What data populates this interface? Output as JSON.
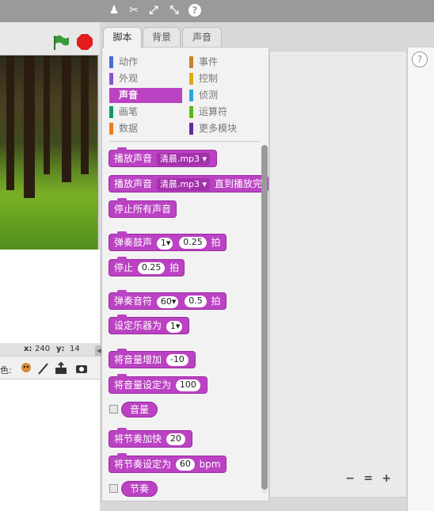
{
  "toolbar": {
    "icons": [
      "stamp-icon",
      "cut-icon",
      "grow-icon",
      "shrink-icon",
      "help-icon"
    ],
    "help_glyph": "?"
  },
  "stage": {
    "coords": {
      "x_label": "x:",
      "x_value": "240",
      "y_label": "y:",
      "y_value": "14"
    },
    "sprite_label": "色:"
  },
  "tabs": [
    "脚本",
    "背景",
    "声音"
  ],
  "categories": {
    "left": [
      {
        "label": "动作",
        "color": "#4a6cd4"
      },
      {
        "label": "外观",
        "color": "#8a55d7"
      },
      {
        "label": "声音",
        "color": "#bb42c3",
        "active": true
      },
      {
        "label": "画笔",
        "color": "#0e9a6c"
      },
      {
        "label": "数据",
        "color": "#ee7d16"
      }
    ],
    "right": [
      {
        "label": "事件",
        "color": "#c88330"
      },
      {
        "label": "控制",
        "color": "#e1a91a"
      },
      {
        "label": "侦测",
        "color": "#2ca5e2"
      },
      {
        "label": "运算符",
        "color": "#5cb712"
      },
      {
        "label": "更多模块",
        "color": "#632d99"
      }
    ]
  },
  "blocks": {
    "play_sound": {
      "label": "播放声音",
      "sound": "清晨.mp3"
    },
    "play_sound_until": {
      "label": "播放声音",
      "sound": "清晨.mp3",
      "suffix": "直到播放完毕"
    },
    "stop_all": "停止所有声音",
    "play_drum": {
      "label": "弹奏鼓声",
      "drum": "1",
      "beats": "0.25",
      "unit": "拍"
    },
    "rest": {
      "label": "停止",
      "beats": "0.25",
      "unit": "拍"
    },
    "play_note": {
      "label": "弹奏音符",
      "note": "60",
      "beats": "0.5",
      "unit": "拍"
    },
    "set_instrument": {
      "label": "设定乐器为",
      "value": "1"
    },
    "change_volume": {
      "label": "将音量增加",
      "value": "-10"
    },
    "set_volume": {
      "label": "将音量设定为",
      "value": "100"
    },
    "volume_reporter": "音量",
    "change_tempo": {
      "label": "将节奏加快",
      "value": "20"
    },
    "set_tempo": {
      "label": "将节奏设定为",
      "value": "60",
      "unit": "bpm"
    },
    "tempo_reporter": "节奏"
  },
  "zoom": {
    "out": "−",
    "reset": "=",
    "in": "+"
  },
  "colors": {
    "sound": "#bb42c3",
    "stop": "#e31b1b",
    "flag": "#2f8f2f"
  }
}
